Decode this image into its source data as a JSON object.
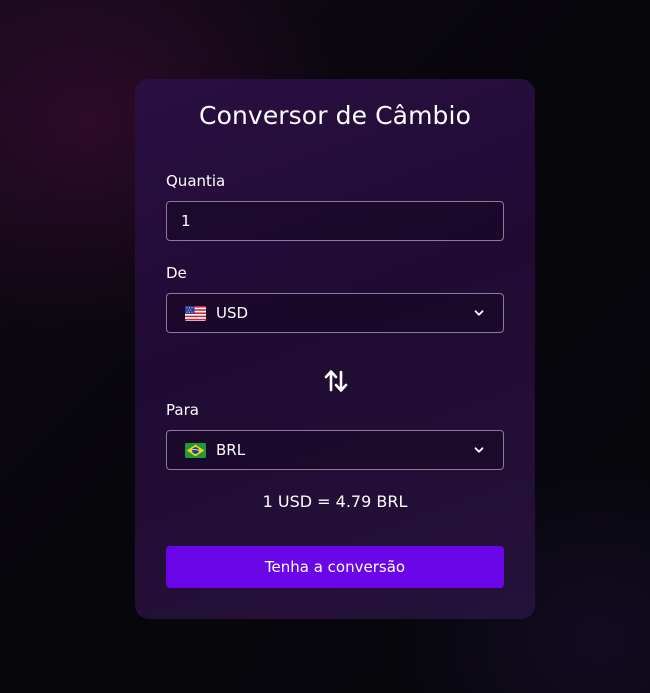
{
  "converter": {
    "title": "Conversor de Câmbio",
    "amount_label": "Quantia",
    "amount_value": "1",
    "from_label": "De",
    "from_currency": "USD",
    "from_flag_icon": "us-flag-icon",
    "to_label": "Para",
    "to_currency": "BRL",
    "to_flag_icon": "brazil-flag-icon",
    "swap_icon": "swap-arrows-icon",
    "result_text": "1 USD = 4.79 BRL",
    "convert_button_label": "Tenha a conversão"
  },
  "colors": {
    "card_background": "#220c36",
    "button_accent": "#6a05e8",
    "field_border": "#8d7aa0",
    "text": "#ffffff"
  }
}
